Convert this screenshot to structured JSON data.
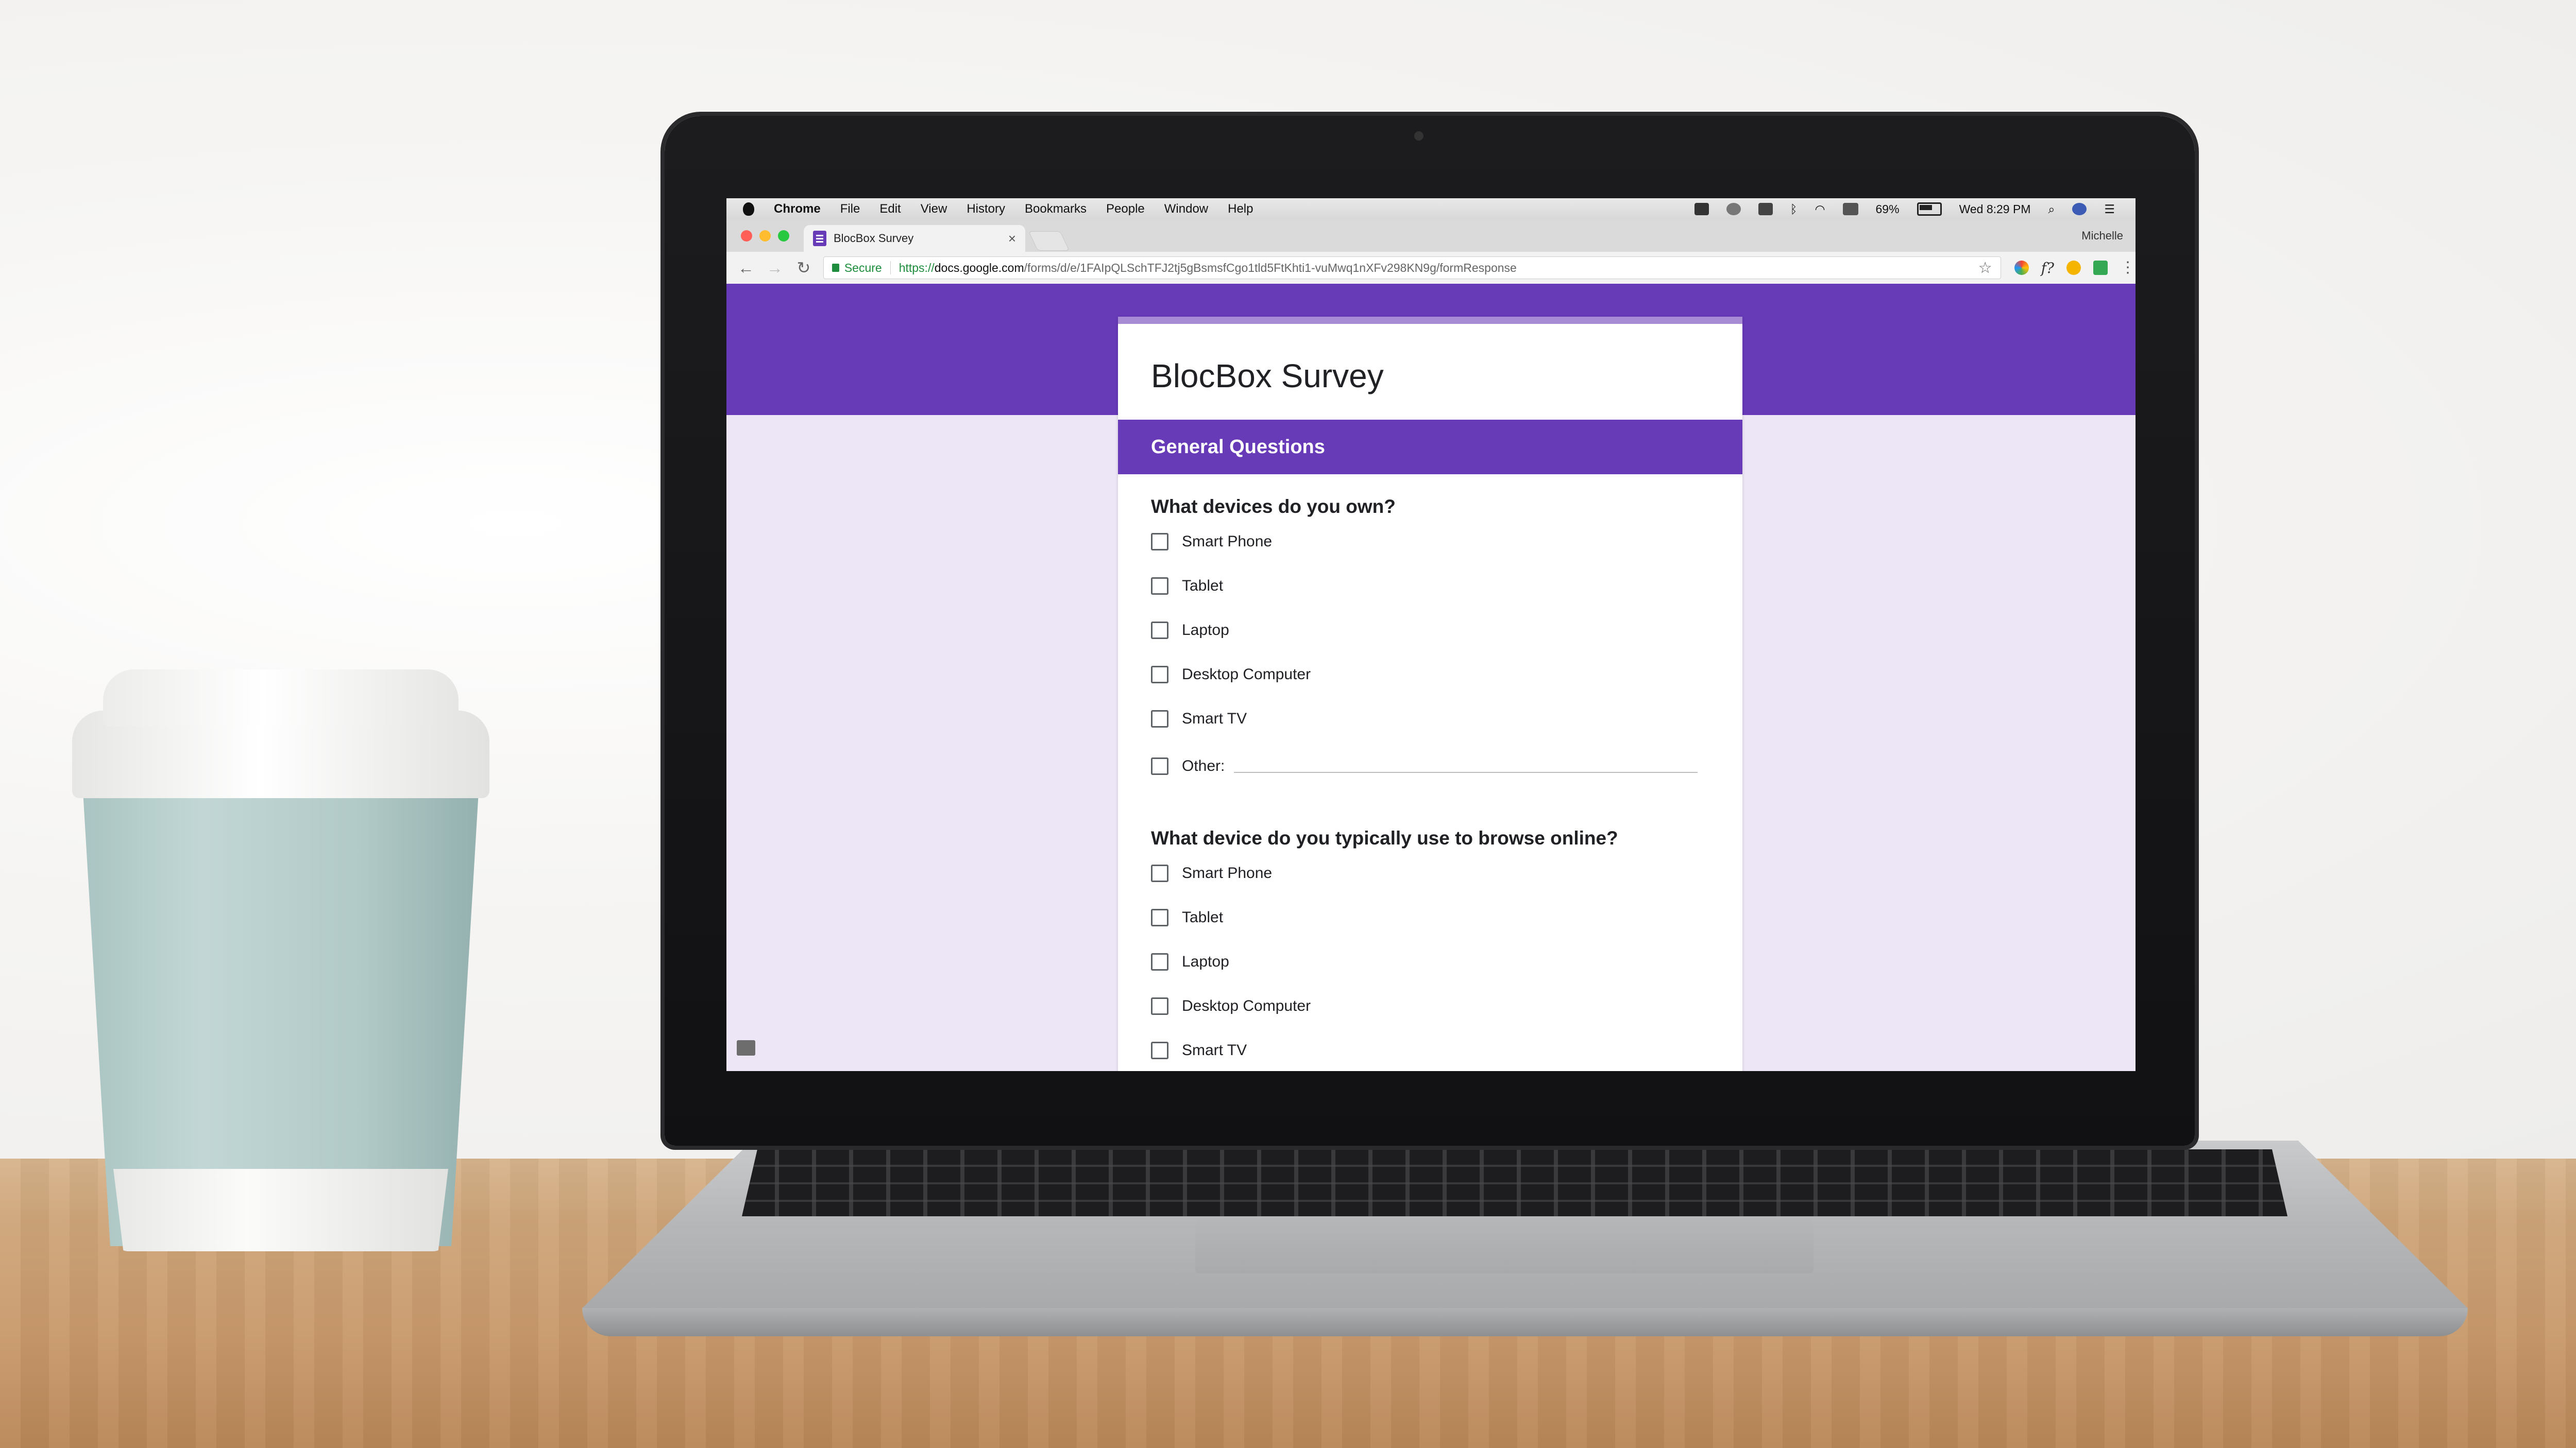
{
  "mac_menubar": {
    "app": "Chrome",
    "menus": [
      "File",
      "Edit",
      "View",
      "History",
      "Bookmarks",
      "People",
      "Window",
      "Help"
    ],
    "battery": "69%",
    "clock": "Wed 8:29 PM"
  },
  "browser": {
    "tab_title": "BlocBox Survey",
    "tab_close": "×",
    "profile_name": "Michelle",
    "security_label": "Secure",
    "url_scheme": "https://",
    "url_host": "docs.google.com",
    "url_path": "/forms/d/e/1FAIpQLSchTFJ2tj5gBsmsfCgo1tld5FtKhti1-vuMwq1nXFv298KN9g/formResponse",
    "back_icon": "←",
    "forward_icon": "→",
    "reload_icon": "↻",
    "star_icon": "☆",
    "ext_f": "f?",
    "ext_menu": "⋮"
  },
  "form": {
    "title": "BlocBox Survey",
    "accent_color": "#673ab7",
    "section_title": "General Questions",
    "questions": [
      {
        "text": "What devices do you own?",
        "options": [
          "Smart Phone",
          "Tablet",
          "Laptop",
          "Desktop Computer",
          "Smart TV",
          "Other:"
        ]
      },
      {
        "text": "What device do you typically use to browse online?",
        "options": [
          "Smart Phone",
          "Tablet",
          "Laptop",
          "Desktop Computer",
          "Smart TV"
        ]
      }
    ]
  }
}
